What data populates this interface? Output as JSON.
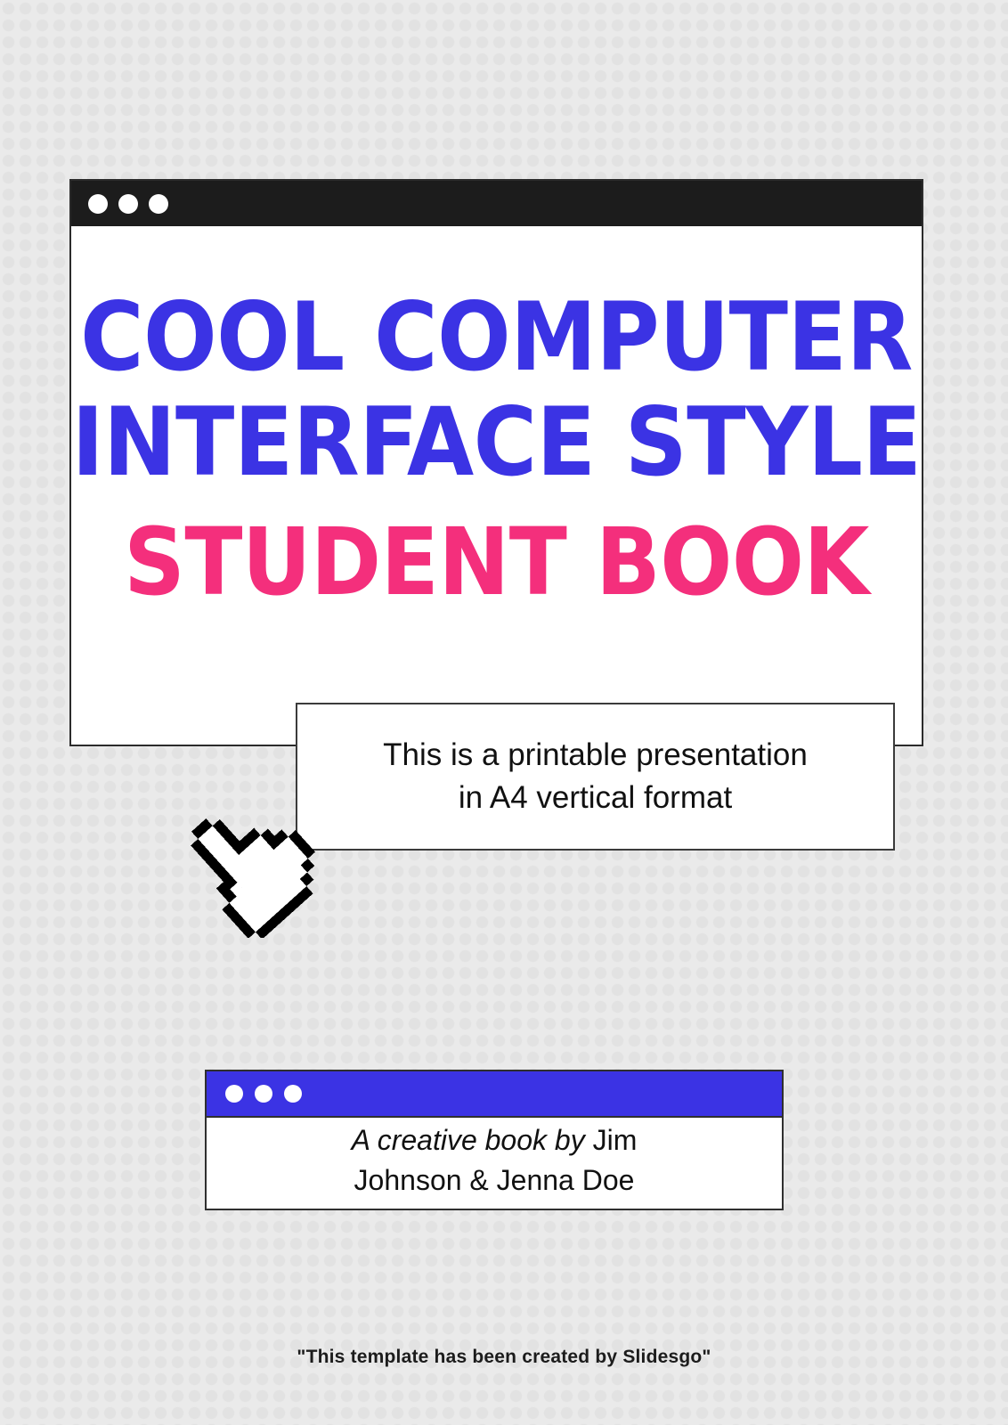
{
  "document": {
    "type": "presentation-cover-slide",
    "format": "A4 vertical"
  },
  "colors": {
    "accent_blue": "#3b33e4",
    "accent_pink": "#f42f7c",
    "titlebar_dark": "#1c1c1c",
    "background": "#eaeaea",
    "background_dot": "#e2e2e2",
    "text_dark": "#111111",
    "border": "#2b2b2b"
  },
  "hero_window": {
    "titlebar": {
      "dots": [
        "window-dot-1",
        "window-dot-2",
        "window-dot-3"
      ],
      "dot_color": "#ffffff",
      "background": "#1c1c1c"
    },
    "title": {
      "line1": "COOL COMPUTER",
      "line2": "INTERFACE STYLE",
      "line3": "STUDENT BOOK",
      "line1_color": "#3b33e4",
      "line2_color": "#3b33e4",
      "line3_color": "#f42f7c"
    }
  },
  "subtitle_box": {
    "line1": "This is a printable presentation",
    "line2": "in A4 vertical format"
  },
  "cursor": {
    "icon": "pixel-pointing-hand-cursor",
    "color": "#000000"
  },
  "author_window": {
    "titlebar": {
      "dots": [
        "window-dot-1",
        "window-dot-2",
        "window-dot-3"
      ],
      "dot_color": "#ffffff",
      "background": "#3b33e4"
    },
    "credit_italic": "A creative book by ",
    "credit_name_part1": "Jim",
    "credit_name_part2": "Johnson & Jenna Doe"
  },
  "footer": {
    "text": "\"This template has been created by Slidesgo\""
  }
}
